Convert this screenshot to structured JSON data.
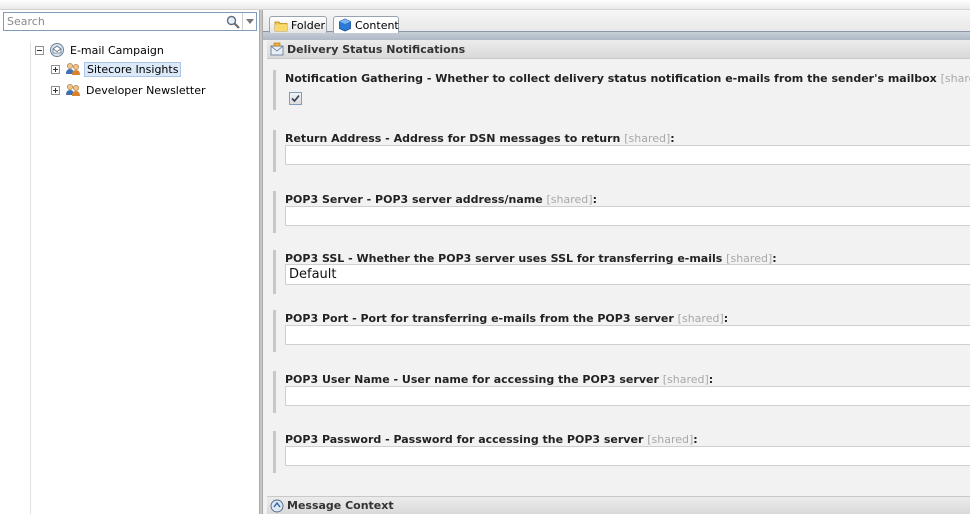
{
  "search": {
    "placeholder": "Search"
  },
  "tree": {
    "root": {
      "label": "E-mail Campaign",
      "expanded": true
    },
    "children": [
      {
        "label": "Sitecore Insights",
        "selected": true
      },
      {
        "label": "Developer Newsletter",
        "selected": false
      }
    ]
  },
  "tabs": [
    {
      "label": "Folder",
      "active": false
    },
    {
      "label": "Content",
      "active": true
    }
  ],
  "sections": {
    "delivery": "Delivery Status Notifications",
    "message_context": "Message Context"
  },
  "shared_tag": "[shared]",
  "fields": [
    {
      "label": "Notification Gathering - Whether to collect delivery status notification e-mails from the sender's mailbox",
      "type": "checkbox",
      "checked": true
    },
    {
      "label": "Return Address - Address for DSN messages to return",
      "type": "text",
      "value": ""
    },
    {
      "label": "POP3 Server - POP3 server address/name",
      "type": "text",
      "value": ""
    },
    {
      "label": "POP3 SSL - Whether the POP3 server uses SSL for transferring e-mails",
      "type": "select",
      "value": "Default"
    },
    {
      "label": "POP3 Port - Port for transferring e-mails from the POP3 server",
      "type": "text",
      "value": ""
    },
    {
      "label": "POP3 User Name - User name for accessing the POP3 server",
      "type": "text",
      "value": ""
    },
    {
      "label": "POP3 Password - Password for accessing the POP3 server",
      "type": "text",
      "value": ""
    }
  ],
  "colon": ":"
}
